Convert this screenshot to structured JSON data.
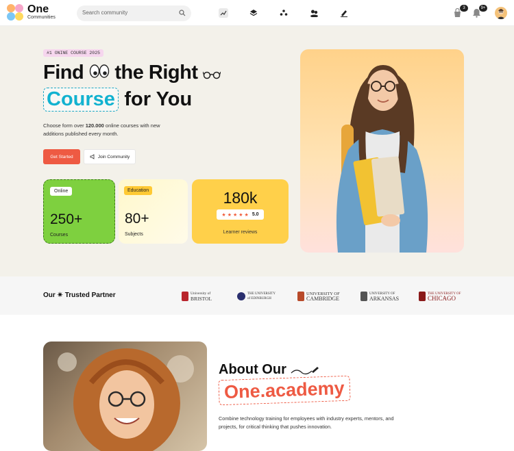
{
  "header": {
    "logo_title": "One",
    "logo_subtitle": "Communities",
    "search_placeholder": "Search community",
    "nav_icons": [
      "chart-icon",
      "layers-icon",
      "people-icon",
      "group-icon",
      "edit-icon"
    ],
    "cart_badge": "3",
    "notification_badge": "9+"
  },
  "hero": {
    "tag": "#1 ONINE COURSE 2025",
    "title_line1": "Find",
    "title_line1_b": "the Right",
    "title_highlight": "Course",
    "title_line2_rest": "for You",
    "description_pre": "Choose form over",
    "description_bold": "120.000",
    "description_post": "online courses with new additions published every month.",
    "cta_primary": "Get Started",
    "cta_secondary": "Join Community",
    "stats": [
      {
        "tag": "Online",
        "value": "250+",
        "label": "Courses"
      },
      {
        "tag": "Education",
        "value": "80+",
        "label": "Subjects"
      }
    ],
    "reviews": {
      "value": "180k",
      "rating": "5.0",
      "label": "Learner reviews"
    }
  },
  "partners": {
    "title": "Our ✴ Trusted Partner",
    "universities": [
      {
        "line1": "University of",
        "line2": "BRISTOL"
      },
      {
        "line1": "THE UNIVERSITY",
        "line2": "of EDINBURGH"
      },
      {
        "line1": "UNIVERSITY OF",
        "line2": "CAMBRIDGE"
      },
      {
        "line1": "UNIVERSITY OF",
        "line2": "ARKANSAS"
      },
      {
        "line1": "THE UNIVERSITY OF",
        "line2": "CHICAGO"
      }
    ]
  },
  "about": {
    "heading": "About Our",
    "brand": "One.academy",
    "description": "Combine technology training for employees with industry experts, mentors, and projects, for critical thinking that pushes innovation."
  },
  "colors": {
    "accent_red": "#ee5a43",
    "accent_cyan": "#12b2d0",
    "green": "#7ed03f",
    "yellow": "#ffd04a"
  }
}
